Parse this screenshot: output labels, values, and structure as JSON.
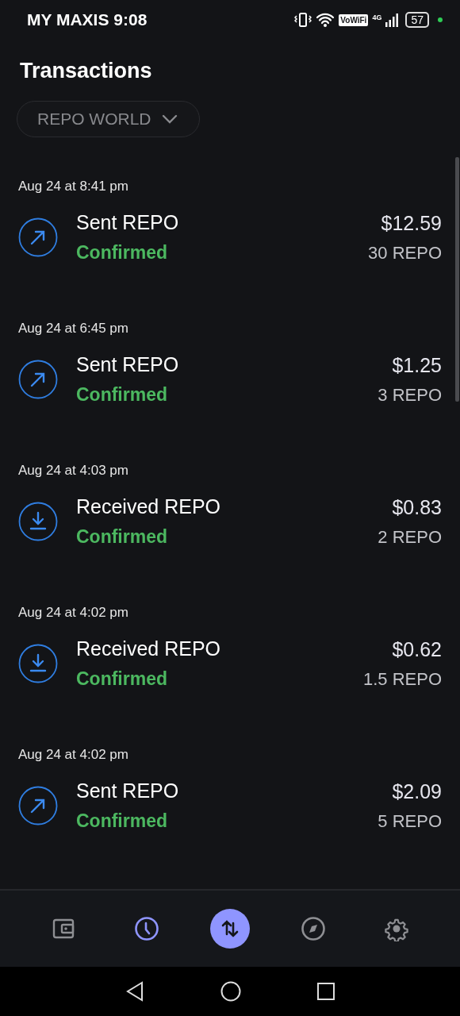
{
  "status_bar": {
    "carrier_time": "MY MAXIS 9:08",
    "vowifi": "VoWiFi",
    "network": "4G",
    "battery": "57"
  },
  "title": "Transactions",
  "filter": {
    "label": "REPO WORLD"
  },
  "transactions": [
    {
      "date": "Aug 24 at 8:41 pm",
      "kind": "sent",
      "title": "Sent REPO",
      "status": "Confirmed",
      "amount": "$12.59",
      "quantity": "30 REPO"
    },
    {
      "date": "Aug 24 at 6:45 pm",
      "kind": "sent",
      "title": "Sent REPO",
      "status": "Confirmed",
      "amount": "$1.25",
      "quantity": "3 REPO"
    },
    {
      "date": "Aug 24 at 4:03 pm",
      "kind": "received",
      "title": "Received REPO",
      "status": "Confirmed",
      "amount": "$0.83",
      "quantity": "2 REPO"
    },
    {
      "date": "Aug 24 at 4:02 pm",
      "kind": "received",
      "title": "Received REPO",
      "status": "Confirmed",
      "amount": "$0.62",
      "quantity": "1.5 REPO"
    },
    {
      "date": "Aug 24 at 4:02 pm",
      "kind": "sent",
      "title": "Sent REPO",
      "status": "Confirmed",
      "amount": "$2.09",
      "quantity": "5 REPO"
    }
  ],
  "bottom_nav": [
    {
      "kind": "wallet",
      "selected": false
    },
    {
      "kind": "history",
      "selected": true
    },
    {
      "kind": "swap",
      "selected": false
    },
    {
      "kind": "explore",
      "selected": false
    },
    {
      "kind": "settings",
      "selected": false
    }
  ]
}
